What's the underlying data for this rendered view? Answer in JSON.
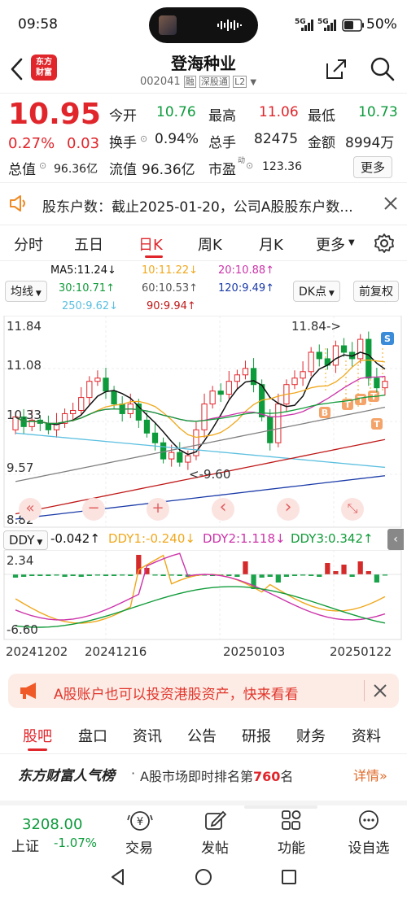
{
  "status_bar": {
    "time": "09:58",
    "battery": "50%",
    "signal1": "5G",
    "signal2": "5G"
  },
  "header": {
    "title": "登海种业",
    "code": "002041",
    "tag1": "融",
    "tag2": "深股通",
    "tag3": "L2"
  },
  "quote": {
    "price": "10.95",
    "change_pct": "0.27%",
    "change": "0.03",
    "open_label": "今开",
    "open": "10.76",
    "high_label": "最高",
    "high": "11.06",
    "low_label": "最低",
    "low": "10.73",
    "turnover_label": "换手",
    "turnover": "0.94%",
    "volume_label": "总手",
    "volume": "82475",
    "amount_label": "金额",
    "amount": "8994万",
    "mktcap_label": "总值",
    "mktcap": "96.36亿",
    "float_label": "流值",
    "float": "96.36亿",
    "pe_label": "市盈",
    "pe_sup": "动",
    "pe": "123.36",
    "more": "更多"
  },
  "notice": {
    "text": "股东户数：截止2025-01-20，公司A股股东户数..."
  },
  "period_tabs": [
    "分时",
    "五日",
    "日K",
    "周K",
    "月K",
    "更多"
  ],
  "active_tab": 2,
  "ma_legend": {
    "ma5": "MA5:11.24↓",
    "ma10": "10:11.22↓",
    "ma20": "20:10.88↑",
    "ma30": "30:10.71↑",
    "ma60": "60:10.53↑",
    "ma120": "120:9.49↑",
    "ma250": "250:9.62↓",
    "ma90": "90:9.94↑"
  },
  "chart_controls": {
    "ma_select": "均线",
    "dk": "DK点",
    "adjust": "前复权"
  },
  "kline": {
    "axis_labels": [
      "11.84",
      "11.08",
      "10.33",
      "9.57",
      "8.82"
    ],
    "high_marker": "11.84->",
    "low_marker": "<-9.60",
    "nav_icons": [
      "«",
      "−",
      "+",
      "‹",
      "›",
      "⤡"
    ],
    "signals": [
      "S",
      "B",
      "T",
      "T",
      "T",
      "T"
    ]
  },
  "ddy": {
    "label": "DDY",
    "ddy": "-0.042↑",
    "ddy1": "DDY1:-0.240↓",
    "ddy2": "DDY2:1.118↓",
    "ddy3": "DDY3:0.342↑",
    "axis_top": "2.34",
    "axis_bottom": "-6.60"
  },
  "dates": [
    "20241202",
    "20241216",
    "20250103",
    "20250122"
  ],
  "promo": {
    "text": "A股账户也可以投资港股资产，快来看看"
  },
  "section_tabs": [
    "股吧",
    "盘口",
    "资讯",
    "公告",
    "研报",
    "财务",
    "资料"
  ],
  "ranking": {
    "brand": "东方财富人气榜",
    "text_prefix": "A股市场即时排名第",
    "rank": "760",
    "text_suffix": "名",
    "more": "详情"
  },
  "bottom_nav": {
    "index_value": "3208.00",
    "index_name": "上证",
    "index_change": "-1.07%",
    "items": [
      "交易",
      "发帖",
      "功能",
      "设自选"
    ]
  },
  "colors": {
    "up": "#e0252b",
    "down": "#0d9b3c",
    "accent": "#e0252b",
    "ma5": "#111111",
    "ma10": "#f0a81c",
    "ma20": "#cc33aa",
    "ma30": "#129c3a",
    "ma60": "#808080",
    "ma120": "#1a3aa8",
    "ma250": "#5bbfe0",
    "ma90": "#c01818"
  }
}
